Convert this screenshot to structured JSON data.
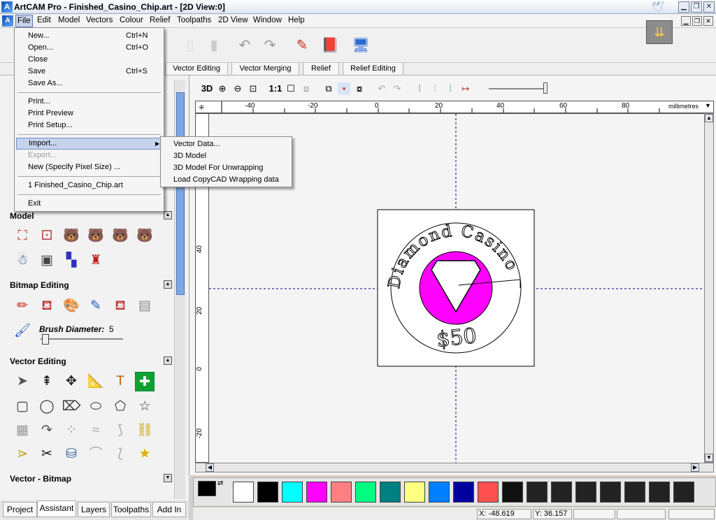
{
  "window": {
    "title": "ArtCAM Pro - Finished_Casino_Chip.art - [2D View:0]",
    "app_icon": "A",
    "doc_icon": "A"
  },
  "menubar": {
    "items": [
      "File",
      "Edit",
      "Model",
      "Vectors",
      "Colour",
      "Relief",
      "Toolpaths",
      "2D View",
      "Window",
      "Help"
    ]
  },
  "file_menu": {
    "items": [
      {
        "label": "New...",
        "shortcut": "Ctrl+N"
      },
      {
        "label": "Open...",
        "shortcut": "Ctrl+O"
      },
      {
        "label": "Close",
        "shortcut": ""
      },
      {
        "label": "Save",
        "shortcut": "Ctrl+S"
      },
      {
        "label": "Save As...",
        "shortcut": ""
      },
      {
        "label": "Print...",
        "shortcut": ""
      },
      {
        "label": "Print Preview",
        "shortcut": ""
      },
      {
        "label": "Print Setup...",
        "shortcut": ""
      },
      {
        "label": "Import...",
        "shortcut": ""
      },
      {
        "label": "Export...",
        "shortcut": ""
      },
      {
        "label": "New (Specify Pixel Size) ...",
        "shortcut": ""
      },
      {
        "label": "1 Finished_Casino_Chip.art",
        "shortcut": ""
      },
      {
        "label": "Exit",
        "shortcut": ""
      }
    ]
  },
  "import_submenu": {
    "items": [
      "Vector Data...",
      "3D Model",
      "3D Model For Unwrapping",
      "Load CopyCAD Wrapping data"
    ]
  },
  "top_tabs": [
    "Vector Editing",
    "Vector Merging",
    "Relief",
    "Relief Editing"
  ],
  "view_toolbar": {
    "3d_label": "3D",
    "one_to_one_label": "1:1"
  },
  "left_panel": {
    "sections": {
      "model": "Model",
      "bitmap_editing": "Bitmap Editing",
      "vector_editing": "Vector Editing",
      "vector_bitmap": "Vector - Bitmap"
    },
    "brush_diameter_label": "Brush Diameter:",
    "brush_diameter_value": "5",
    "bottom_tabs": [
      "Project",
      "Assistant",
      "Layers",
      "Toolpaths",
      "Add In"
    ]
  },
  "rulers": {
    "unit": "millimetres",
    "top_labels": [
      "-40",
      "-20",
      "0",
      "20",
      "40",
      "60",
      "80"
    ],
    "left_labels": [
      "40",
      "20",
      "0",
      "-20"
    ]
  },
  "artwork": {
    "arc_text": "Diamond Casino",
    "value_text": "$50",
    "fill_color": "#ff00ff"
  },
  "palette": {
    "colors": [
      "#ffffff",
      "#000000",
      "#00ffff",
      "#ff00ff",
      "#ff8080",
      "#00ff80",
      "#008080",
      "#ffff80",
      "#0080ff",
      "#0000a0",
      "#ff5050",
      "#111111",
      "#222222",
      "#222222",
      "#222222",
      "#222222",
      "#222222",
      "#222222",
      "#222222"
    ]
  },
  "status": {
    "x": "X: -48.619",
    "y": "Y: 36.157"
  }
}
